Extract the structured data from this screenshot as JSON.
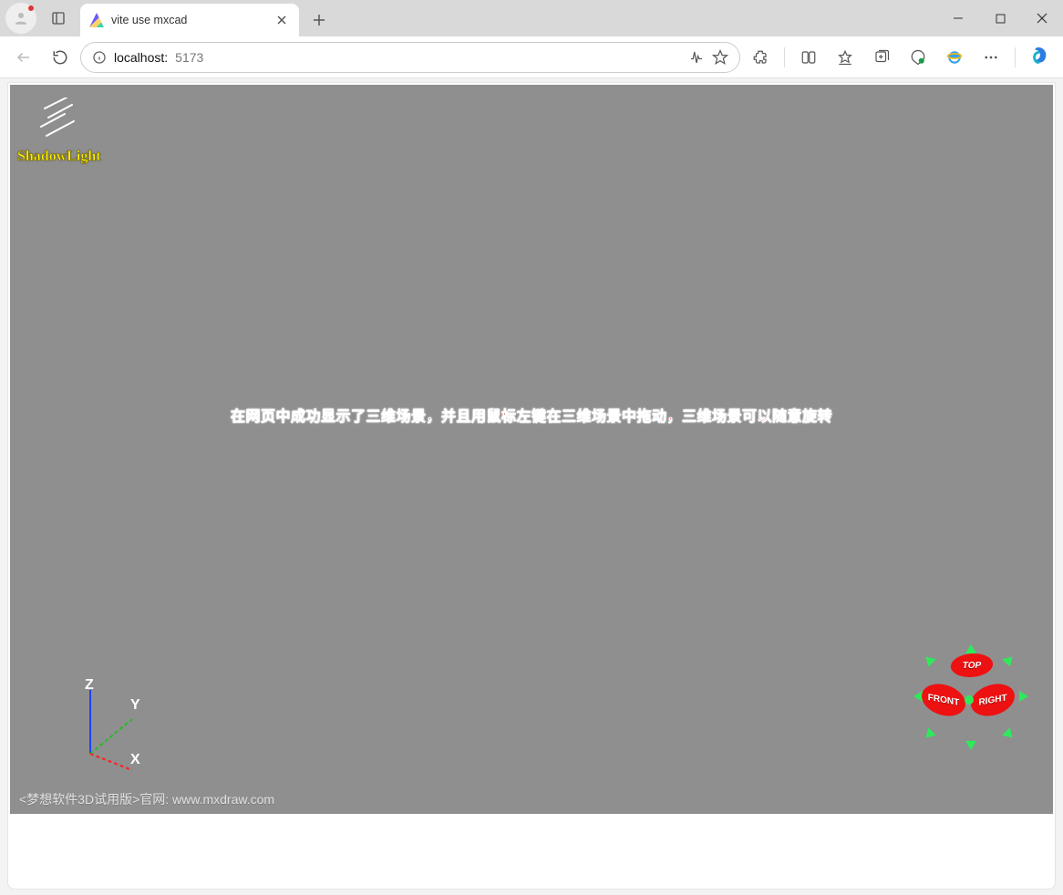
{
  "window": {
    "tab_title": "vite use mxcad"
  },
  "address": {
    "info_icon": "info-icon",
    "host": "localhost:",
    "port": "5173"
  },
  "toolbar_icons": {
    "read_aloud": "read-aloud-icon",
    "star": "star-icon",
    "extensions": "extensions-icon",
    "split": "split-screen-icon",
    "favorites": "favorites-icon",
    "collections": "collections-icon",
    "perf": "performance-icon",
    "ie": "ie-mode-icon",
    "more": "more-icon",
    "copilot": "copilot-icon"
  },
  "scene": {
    "shadowlight_label": "ShadowLight",
    "annotation": "在网页中成功显示了三维场景，并且用鼠标左键在三维场景中拖动，三维场景可以随意旋转",
    "watermark": "<梦想软件3D试用版>官网: www.mxdraw.com",
    "axis": {
      "x": "X",
      "y": "Y",
      "z": "Z"
    },
    "cube": {
      "top": "TOP",
      "front": "FRONT",
      "right": "RIGHT"
    }
  }
}
